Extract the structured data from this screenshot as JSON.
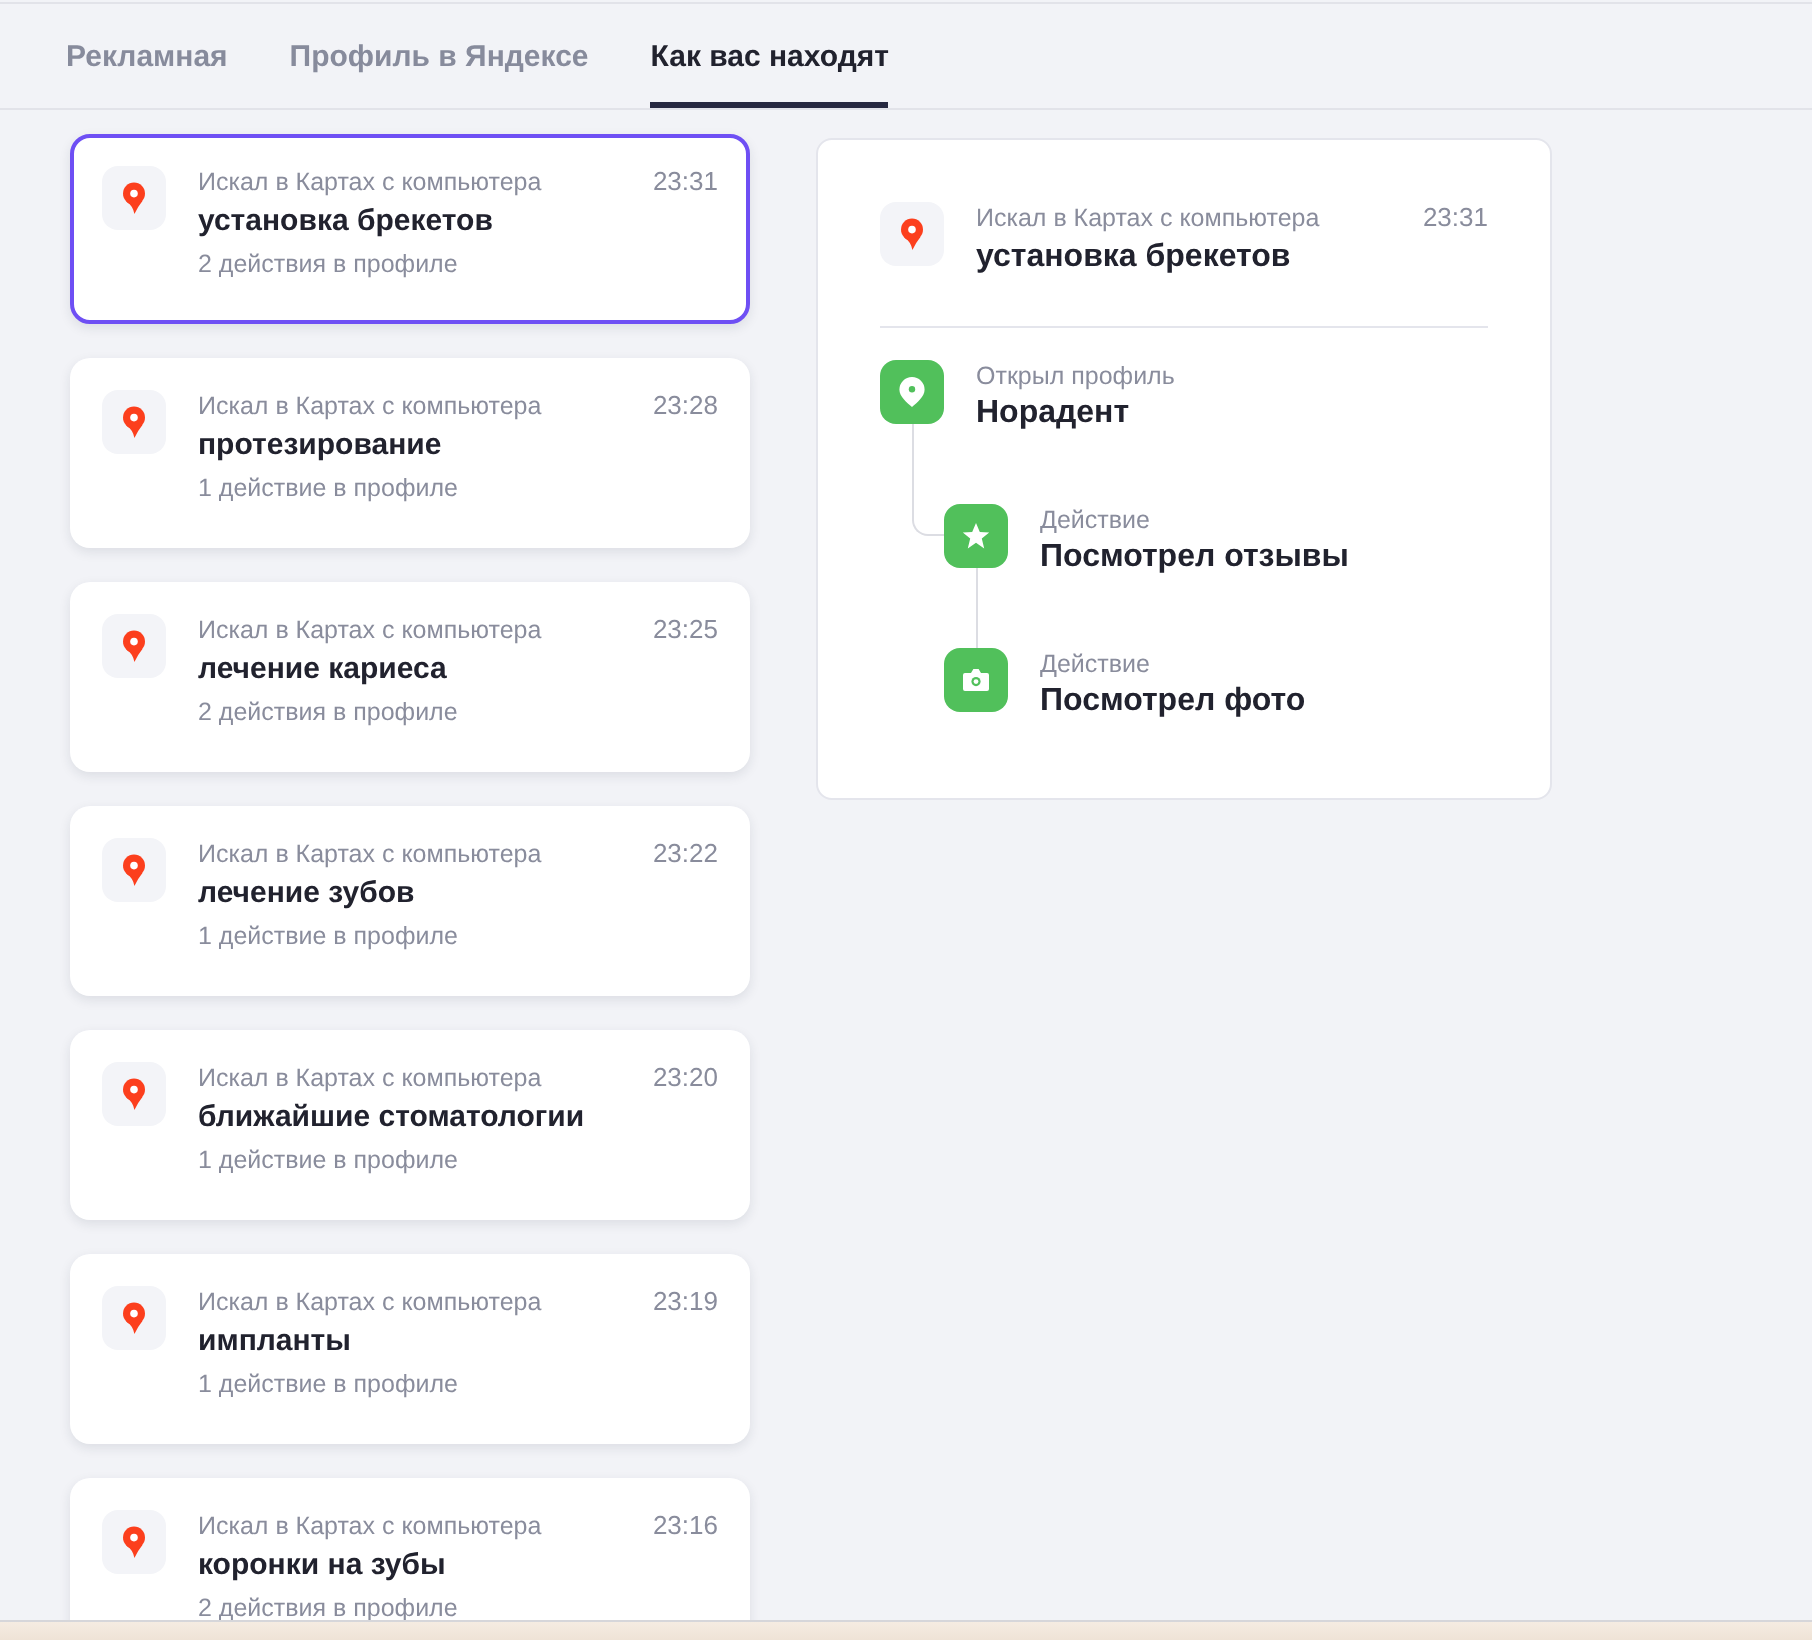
{
  "tabs": [
    {
      "label": "Рекламная",
      "selected": false
    },
    {
      "label": "Профиль в Яндексе",
      "selected": false
    },
    {
      "label": "Как вас находят",
      "selected": true
    }
  ],
  "searches": [
    {
      "source": "Искал в Картах с компьютера",
      "query": "установка брекетов",
      "time": "23:31",
      "actions": "2 действия в профиле",
      "selected": true
    },
    {
      "source": "Искал в Картах с компьютера",
      "query": "протезирование",
      "time": "23:28",
      "actions": "1 действие в профиле",
      "selected": false
    },
    {
      "source": "Искал в Картах с компьютера",
      "query": "лечение кариеса",
      "time": "23:25",
      "actions": "2 действия в профиле",
      "selected": false
    },
    {
      "source": "Искал в Картах с компьютера",
      "query": "лечение зубов",
      "time": "23:22",
      "actions": "1 действие в профиле",
      "selected": false
    },
    {
      "source": "Искал в Картах с компьютера",
      "query": "ближайшие стоматологии",
      "time": "23:20",
      "actions": "1 действие в профиле",
      "selected": false
    },
    {
      "source": "Искал в Картах с компьютера",
      "query": "импланты",
      "time": "23:19",
      "actions": "1 действие в профиле",
      "selected": false
    },
    {
      "source": "Искал в Картах с компьютера",
      "query": "коронки на зубы",
      "time": "23:16",
      "actions": "2 действия в профиле",
      "selected": false
    }
  ],
  "detail": {
    "source": "Искал в Картах с компьютера",
    "query": "установка брекетов",
    "time": "23:31",
    "timeline": [
      {
        "kind": "profile",
        "label": "Открыл профиль",
        "title": "Норадент",
        "children": [
          {
            "kind": "reviews",
            "label": "Действие",
            "title": "Посмотрел отзывы"
          },
          {
            "kind": "photo",
            "label": "Действие",
            "title": "Посмотрел фото"
          }
        ]
      }
    ]
  }
}
